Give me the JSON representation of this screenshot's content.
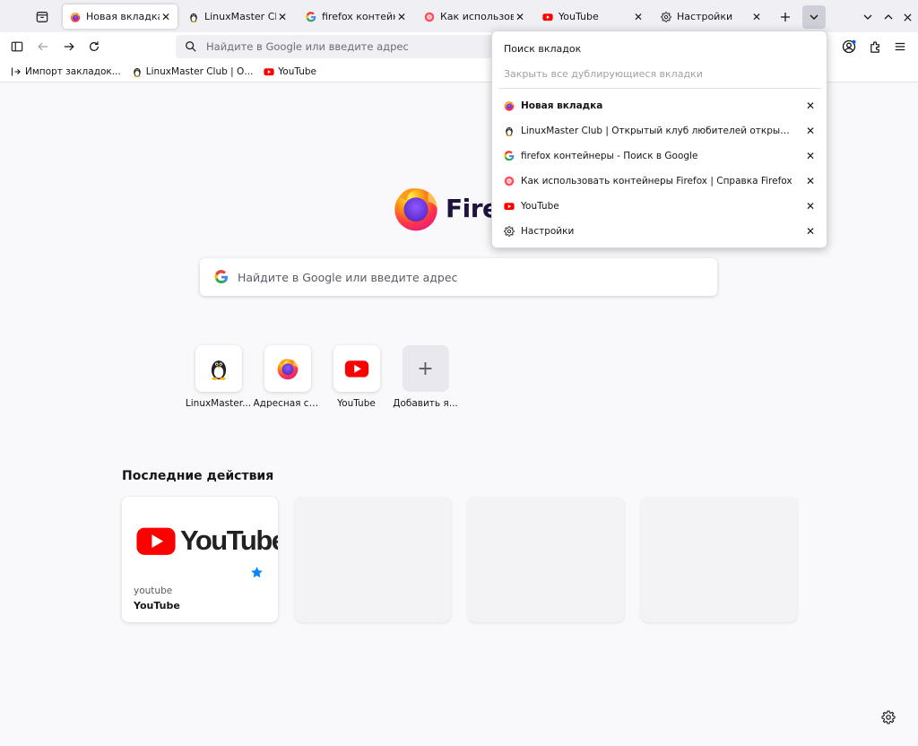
{
  "tabs": [
    {
      "title": "Новая вкладка",
      "icon": "firefox-icon",
      "selected": true
    },
    {
      "title": "LinuxMaster Club",
      "icon": "tux-icon"
    },
    {
      "title": "firefox контейнеры",
      "icon": "google-icon"
    },
    {
      "title": "Как использовать",
      "icon": "firefox-support-icon"
    },
    {
      "title": "YouTube",
      "icon": "youtube-icon"
    },
    {
      "title": "Настройки",
      "icon": "gear-icon"
    }
  ],
  "tab_close_glyph": "✕",
  "urlbar": {
    "placeholder": "Найдите в Google или введите адрес"
  },
  "bookmarks": [
    {
      "label": "Импорт закладок...",
      "icon": "import-icon"
    },
    {
      "label": "LinuxMaster Club | О...",
      "icon": "tux-icon"
    },
    {
      "label": "YouTube",
      "icon": "youtube-icon"
    }
  ],
  "newtab": {
    "wordmark": "Fire",
    "search_placeholder": "Найдите в Google или введите адрес",
    "shortcuts": [
      {
        "label": "LinuxMaster...",
        "icon": "tux-icon"
      },
      {
        "label": "Адресная ст...",
        "icon": "firefox-icon"
      },
      {
        "label": "YouTube",
        "icon": "youtube-icon"
      },
      {
        "label": "Добавить я...",
        "icon": "plus-icon",
        "glyph": "+"
      }
    ],
    "recent_title": "Последние действия",
    "recent_cards": [
      {
        "logo_text": "YouTube",
        "host": "youtube",
        "title": "YouTube",
        "bookmarked": true
      }
    ]
  },
  "all_tabs_panel": {
    "search_label": "Поиск вкладок",
    "close_duplicates_label": "Закрыть все дублирующиеся вкладки",
    "items": [
      {
        "title": "Новая вкладка",
        "icon": "firefox-icon",
        "active": true
      },
      {
        "title": "LinuxMaster Club | Открытый клуб любителей открытого ПО",
        "icon": "tux-icon"
      },
      {
        "title": "firefox контейнеры - Поиск в Google",
        "icon": "google-icon"
      },
      {
        "title": "Как использовать контейнеры Firefox | Справка Firefox",
        "icon": "firefox-support-icon"
      },
      {
        "title": "YouTube",
        "icon": "youtube-icon"
      },
      {
        "title": "Настройки",
        "icon": "gear-icon"
      }
    ]
  },
  "colors": {
    "accent_blue": "#0060df",
    "youtube_red": "#ff0000",
    "toolbar_bg": "#f0f0f4",
    "page_bg": "#f9f9fb"
  }
}
